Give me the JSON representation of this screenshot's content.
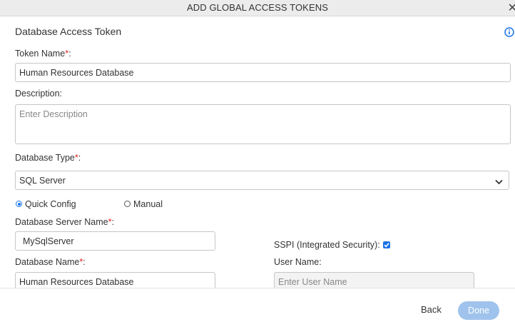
{
  "dialog": {
    "title": "ADD GLOBAL ACCESS TOKENS",
    "close_glyph": "✕"
  },
  "form": {
    "section_title": "Database Access Token",
    "required_mark": "*",
    "colon": ":",
    "token_name": {
      "label": "Token Name",
      "value": "Human Resources Database"
    },
    "description": {
      "label": "Description:",
      "placeholder": "Enter Description"
    },
    "database_type": {
      "label": "Database Type",
      "value": "SQL Server"
    },
    "config_mode": {
      "quick_label": "Quick Config",
      "manual_label": "Manual",
      "selected": "Quick Config"
    },
    "server_name": {
      "label": "Database Server Name",
      "value": "MySqlServer"
    },
    "sspi": {
      "label": "SSPI (Integrated Security):",
      "checked": true
    },
    "database_name": {
      "label": "Database Name",
      "value": "Human Resources Database"
    },
    "user_name": {
      "label": "User Name:",
      "placeholder": "Enter User Name"
    }
  },
  "footer": {
    "back_label": "Back",
    "done_label": "Done"
  },
  "icons": {
    "info": "info-circle-icon",
    "chevron": "chevron-down-icon",
    "close": "close-icon",
    "check": "check-icon"
  },
  "colors": {
    "accent": "#1a73e8",
    "required": "#e0211f",
    "done_button": "#9fc3ec",
    "titlebar": "#ececec"
  }
}
